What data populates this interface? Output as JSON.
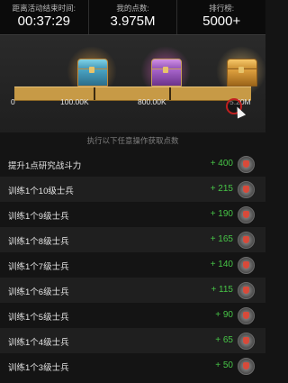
{
  "header": {
    "time_left_label": "距离活动结束时间:",
    "time_left_value": "00:37:29",
    "my_points_label": "我的点数:",
    "my_points_value": "3.975M",
    "rank_label": "排行榜:",
    "rank_value": "5000+"
  },
  "progress": {
    "ticks": [
      "0",
      "100.00K",
      "800.00K",
      "5.20M"
    ],
    "current_value": "3.975M"
  },
  "instruction": "执行以下任意操作获取点数",
  "tasks": [
    {
      "label": "提升1点研究战斗力",
      "points": "+ 400"
    },
    {
      "label": "训练1个10级士兵",
      "points": "+ 215"
    },
    {
      "label": "训练1个9级士兵",
      "points": "+ 190"
    },
    {
      "label": "训练1个8级士兵",
      "points": "+ 165"
    },
    {
      "label": "训练1个7级士兵",
      "points": "+ 140"
    },
    {
      "label": "训练1个6级士兵",
      "points": "+ 115"
    },
    {
      "label": "训练1个5级士兵",
      "points": "+ 90"
    },
    {
      "label": "训练1个4级士兵",
      "points": "+ 65"
    },
    {
      "label": "训练1个3级士兵",
      "points": "+ 50"
    }
  ]
}
